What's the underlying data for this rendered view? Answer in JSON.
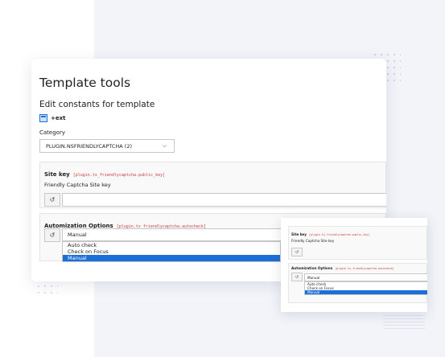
{
  "page": {
    "title": "Template tools",
    "subtitle": "Edit constants for template",
    "ext_label": "+ext"
  },
  "category": {
    "label": "Category",
    "selected": "PLUGIN.NSFRIENDLYCAPTCHA (2)"
  },
  "site_key": {
    "title": "Site key",
    "key": "[plugin.tx_friendlycaptcha.public_key]",
    "description": "Friendly Captcha Site key",
    "value": ""
  },
  "autocheck": {
    "title": "Automization Options",
    "key": "[plugin.tx_friendlycaptcha.autocheck]",
    "selected": "Manual",
    "options": [
      "Auto check",
      "Check on Focus",
      "Manual"
    ]
  },
  "reset_glyph": "↺",
  "icons": [
    "extension-icon",
    "chevron-down-icon",
    "reset-icon"
  ],
  "colors": {
    "accent": "#1d6fd8",
    "key_text": "#c83c3c",
    "background_panel": "#f2f4f9"
  }
}
